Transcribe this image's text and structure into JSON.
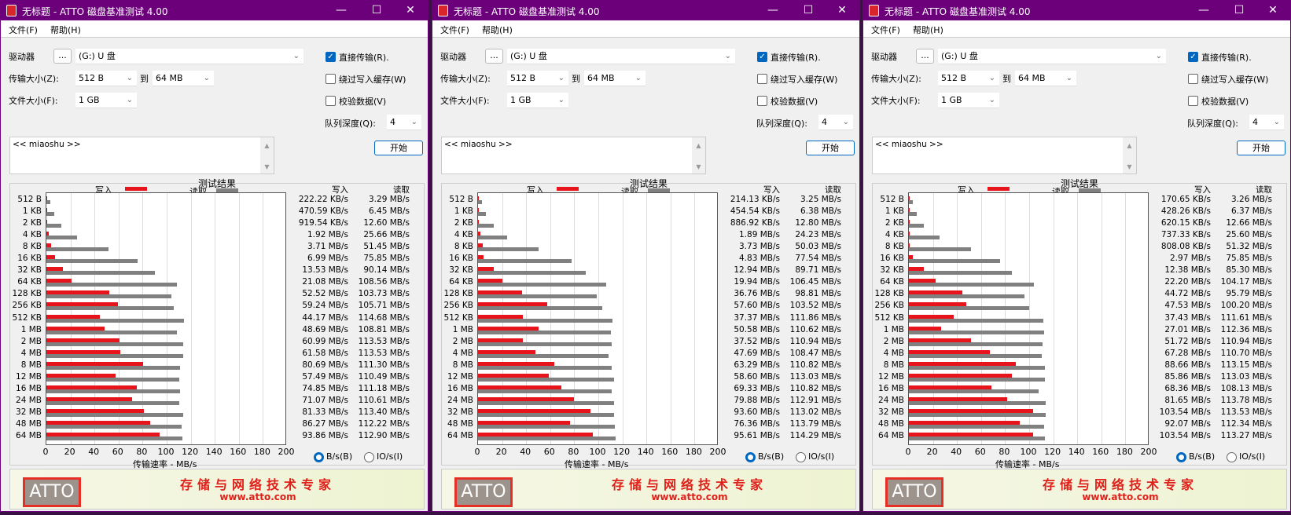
{
  "app": {
    "title": "无标题 - ATTO 磁盘基准测试 4.00",
    "menu": [
      "文件(F)",
      "帮助(H)"
    ],
    "drive_label": "驱动器",
    "browse_button": "...",
    "drive_value": "(G:) U 盘",
    "transfer_label": "传输大小(Z):",
    "transfer_from": "512 B",
    "to_label": "到",
    "transfer_to": "64 MB",
    "filesize_label": "文件大小(F):",
    "filesize_value": "1 GB",
    "direct_io": {
      "label": "直接传输(R).",
      "checked": true
    },
    "bypass_cache": {
      "label": "绕过写入缓存(W)",
      "checked": false
    },
    "verify": {
      "label": "校验数据(V)",
      "checked": false
    },
    "queue_label": "队列深度(Q):",
    "queue_value": "4",
    "description": "<< miaoshu >>",
    "start_button": "开始",
    "results_title": "测试结果",
    "legend_write": "写入",
    "legend_read": "读取",
    "col_write": "写入",
    "col_read": "读取",
    "xlabel": "传输速率 - MB/s",
    "radio_bytes": "B/s(B)",
    "radio_io": "IO/s(I)",
    "banner_slogan": "存储与网络技术专家",
    "banner_url": "www.atto.com",
    "logo_text": "ATTO",
    "colors": {
      "write": "#e8141c",
      "read": "#808080",
      "titlebar": "#6b007a"
    }
  },
  "chart_data": {
    "type": "bar",
    "categories": [
      "512 B",
      "1 KB",
      "2 KB",
      "4 KB",
      "8 KB",
      "16 KB",
      "32 KB",
      "64 KB",
      "128 KB",
      "256 KB",
      "512 KB",
      "1 MB",
      "2 MB",
      "4 MB",
      "8 MB",
      "12 MB",
      "16 MB",
      "24 MB",
      "32 MB",
      "48 MB",
      "64 MB"
    ],
    "xticks": [
      "0",
      "20",
      "40",
      "60",
      "80",
      "100",
      "120",
      "140",
      "160",
      "180",
      "200"
    ],
    "xlim": [
      0,
      200
    ]
  },
  "windows": [
    {
      "write": [
        "222.22 KB/s",
        "470.59 KB/s",
        "919.54 KB/s",
        "1.92 MB/s",
        "3.71 MB/s",
        "6.99 MB/s",
        "13.53 MB/s",
        "21.08 MB/s",
        "52.52 MB/s",
        "59.24 MB/s",
        "44.17 MB/s",
        "48.69 MB/s",
        "60.99 MB/s",
        "61.58 MB/s",
        "80.69 MB/s",
        "57.49 MB/s",
        "74.85 MB/s",
        "71.07 MB/s",
        "81.33 MB/s",
        "86.27 MB/s",
        "93.86 MB/s"
      ],
      "read": [
        "3.29 MB/s",
        "6.45 MB/s",
        "12.60 MB/s",
        "25.66 MB/s",
        "51.45 MB/s",
        "75.85 MB/s",
        "90.14 MB/s",
        "108.56 MB/s",
        "103.73 MB/s",
        "105.71 MB/s",
        "114.68 MB/s",
        "108.81 MB/s",
        "113.53 MB/s",
        "113.53 MB/s",
        "111.30 MB/s",
        "110.49 MB/s",
        "111.18 MB/s",
        "110.61 MB/s",
        "113.40 MB/s",
        "112.22 MB/s",
        "112.90 MB/s"
      ]
    },
    {
      "write": [
        "214.13 KB/s",
        "454.54 KB/s",
        "886.92 KB/s",
        "1.89 MB/s",
        "3.73 MB/s",
        "4.83 MB/s",
        "12.94 MB/s",
        "19.94 MB/s",
        "36.76 MB/s",
        "57.60 MB/s",
        "37.37 MB/s",
        "50.58 MB/s",
        "37.52 MB/s",
        "47.69 MB/s",
        "63.29 MB/s",
        "58.60 MB/s",
        "69.33 MB/s",
        "79.88 MB/s",
        "93.60 MB/s",
        "76.36 MB/s",
        "95.61 MB/s"
      ],
      "read": [
        "3.25 MB/s",
        "6.38 MB/s",
        "12.80 MB/s",
        "24.23 MB/s",
        "50.03 MB/s",
        "77.54 MB/s",
        "89.71 MB/s",
        "106.45 MB/s",
        "98.81 MB/s",
        "103.52 MB/s",
        "111.86 MB/s",
        "110.62 MB/s",
        "110.94 MB/s",
        "108.47 MB/s",
        "110.82 MB/s",
        "113.03 MB/s",
        "110.82 MB/s",
        "112.91 MB/s",
        "113.02 MB/s",
        "113.79 MB/s",
        "114.29 MB/s"
      ]
    },
    {
      "write": [
        "170.65 KB/s",
        "428.26 KB/s",
        "620.15 KB/s",
        "737.33 KB/s",
        "808.08 KB/s",
        "2.97 MB/s",
        "12.38 MB/s",
        "22.20 MB/s",
        "44.72 MB/s",
        "47.53 MB/s",
        "37.43 MB/s",
        "27.01 MB/s",
        "51.72 MB/s",
        "67.28 MB/s",
        "88.66 MB/s",
        "85.86 MB/s",
        "68.36 MB/s",
        "81.65 MB/s",
        "103.54 MB/s",
        "92.07 MB/s",
        "103.54 MB/s"
      ],
      "read": [
        "3.26 MB/s",
        "6.37 MB/s",
        "12.66 MB/s",
        "25.60 MB/s",
        "51.32 MB/s",
        "75.85 MB/s",
        "85.30 MB/s",
        "104.17 MB/s",
        "95.79 MB/s",
        "100.20 MB/s",
        "111.61 MB/s",
        "112.36 MB/s",
        "110.94 MB/s",
        "110.70 MB/s",
        "113.15 MB/s",
        "113.03 MB/s",
        "108.13 MB/s",
        "113.78 MB/s",
        "113.53 MB/s",
        "112.34 MB/s",
        "113.27 MB/s"
      ]
    }
  ]
}
